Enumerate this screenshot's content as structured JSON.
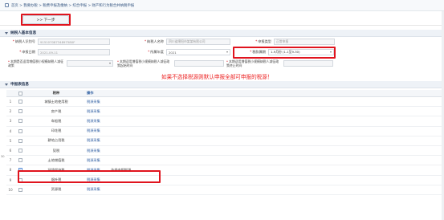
{
  "breadcrumb": {
    "text": "首页 > 我要办税 > 税费申报及缴纳 > 综合申报 > 财产和行为税合并纳税申报"
  },
  "toolbar": {
    "next_label": ">> 下一步"
  },
  "taxpayer_section": {
    "title": "纳税人基本信息",
    "fields": {
      "taxpayer_id_label": "纳税人识别号",
      "taxpayer_id_value": "9151070873489758XF",
      "taxpayer_name_label": "纳税人名称",
      "taxpayer_name_value": "四川省绵阳市某某有限公司",
      "declare_type_label": "申报类型",
      "declare_type_value": "正常申报",
      "declare_date_label": "申报日期",
      "declare_date_value": "2021-09-11",
      "tax_year_label": "所属年度",
      "tax_year_value": "2021",
      "tax_period_label": "税款属期",
      "tax_period_value": "1-9月份 (1-1至9-30)",
      "reduction_label_1": "本期是否适用增值税小规模纳税人减征政策",
      "reduction_label_2": "本期适用增值税小规模纳税人减征政策起始时间",
      "reduction_label_3": "本期适用增值税小规模纳税人减征政策终止时间"
    }
  },
  "notice": {
    "text": "如果不选择税源则默认申报全部可申报的税源！"
  },
  "declare_section": {
    "title": "申报表信息",
    "columns": [
      "",
      "",
      "税种",
      "操作"
    ],
    "side_mark": "30",
    "rows": [
      {
        "num": "1",
        "name": "城镇土地使用税",
        "op": "税源采集",
        "checked": false,
        "extra": ""
      },
      {
        "num": "2",
        "name": "房产税",
        "op": "税源采集",
        "checked": false,
        "extra": ""
      },
      {
        "num": "3",
        "name": "车船税",
        "op": "税源采集",
        "checked": false,
        "extra": ""
      },
      {
        "num": "4",
        "name": "印花税",
        "op": "税源采集",
        "checked": false,
        "extra": ""
      },
      {
        "num": "5",
        "name": "耕地占用税",
        "op": "税源采集",
        "checked": false,
        "extra": ""
      },
      {
        "num": "6",
        "name": "契税",
        "op": "税源采集",
        "checked": false,
        "extra": ""
      },
      {
        "num": "7",
        "name": "土地增值税",
        "op": "税源采集",
        "checked": false,
        "extra": ""
      },
      {
        "num": "8",
        "name": "环境保护税",
        "op": "税源采集",
        "checked": true,
        "extra": "选择申报税源"
      },
      {
        "num": "9",
        "name": "烟叶税",
        "op": "税源采集",
        "checked": false,
        "extra": ""
      },
      {
        "num": "10",
        "name": "资源税",
        "op": "税源采集",
        "checked": false,
        "extra": ""
      }
    ]
  },
  "colors": {
    "highlight_red": "#e0141e",
    "notice_red": "#ec2424",
    "link_blue": "#2d5da1"
  }
}
